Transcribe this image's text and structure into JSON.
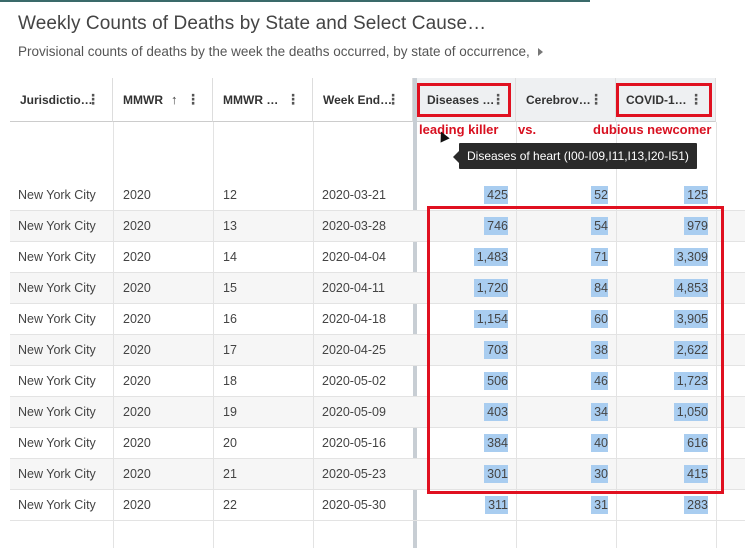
{
  "dataset": {
    "title": "Weekly Counts of Deaths by State and Select Cause…",
    "subtitle": "Provisional counts of deaths by the week the deaths occurred, by state of occurrence,"
  },
  "columns": [
    {
      "label": "Jurisdictio…"
    },
    {
      "label": "MMWR"
    },
    {
      "label": "MMWR …"
    },
    {
      "label": "Week End…"
    },
    {
      "label": "Diseases …"
    },
    {
      "label": "Cerebrov…"
    },
    {
      "label": "COVID-1…"
    }
  ],
  "annotations": {
    "leading": "leading killer",
    "vs": "vs.",
    "newcomer": "dubious newcomer"
  },
  "tooltip": "Diseases of heart (I00-I09,I11,I13,I20-I51)",
  "rows": [
    [
      "New York City",
      "2020",
      "12",
      "2020-03-21",
      "425",
      "52",
      "125"
    ],
    [
      "New York City",
      "2020",
      "13",
      "2020-03-28",
      "746",
      "54",
      "979"
    ],
    [
      "New York City",
      "2020",
      "14",
      "2020-04-04",
      "1,483",
      "71",
      "3,309"
    ],
    [
      "New York City",
      "2020",
      "15",
      "2020-04-11",
      "1,720",
      "84",
      "4,853"
    ],
    [
      "New York City",
      "2020",
      "16",
      "2020-04-18",
      "1,154",
      "60",
      "3,905"
    ],
    [
      "New York City",
      "2020",
      "17",
      "2020-04-25",
      "703",
      "38",
      "2,622"
    ],
    [
      "New York City",
      "2020",
      "18",
      "2020-05-02",
      "506",
      "46",
      "1,723"
    ],
    [
      "New York City",
      "2020",
      "19",
      "2020-05-09",
      "403",
      "34",
      "1,050"
    ],
    [
      "New York City",
      "2020",
      "20",
      "2020-05-16",
      "384",
      "40",
      "616"
    ],
    [
      "New York City",
      "2020",
      "21",
      "2020-05-23",
      "301",
      "30",
      "415"
    ],
    [
      "New York City",
      "2020",
      "22",
      "2020-05-30",
      "311",
      "31",
      "283"
    ]
  ]
}
